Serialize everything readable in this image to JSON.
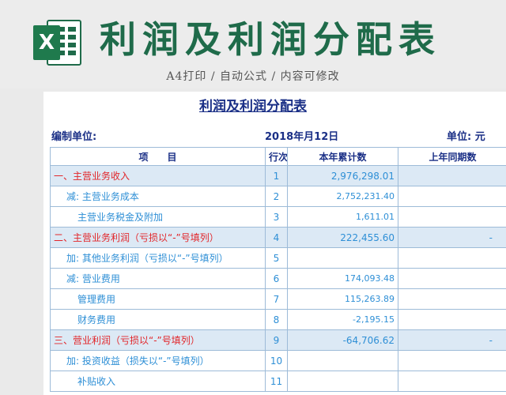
{
  "banner": {
    "title": "利润及利润分配表",
    "subtitle": "A4打印 / 自动公式 / 内容可修改",
    "icon": "excel-icon",
    "brand_color": "#1f6b4a"
  },
  "sheet": {
    "title": "利润及利润分配表",
    "unit_label": "编制单位:",
    "date": "2018年月12日",
    "currency_label": "单位: 元",
    "columns": [
      "项　　目",
      "行次",
      "本年累计数",
      "上年同期数"
    ],
    "rows": [
      {
        "name": "一、主营业务收入",
        "idx": "1",
        "current": "2,976,298.01",
        "previous": "",
        "highlight": true,
        "level": 0,
        "red": true
      },
      {
        "name": "减: 主营业务成本",
        "idx": "2",
        "current": "2,752,231.40",
        "previous": "",
        "highlight": false,
        "level": 1,
        "red": false
      },
      {
        "name": "主营业务税金及附加",
        "idx": "3",
        "current": "1,611.01",
        "previous": "",
        "highlight": false,
        "level": 2,
        "red": false
      },
      {
        "name": "二、主营业务利润（亏损以“-”号填列）",
        "idx": "4",
        "current": "222,455.60",
        "previous": "-",
        "highlight": true,
        "level": 0,
        "red": true
      },
      {
        "name": "加: 其他业务利润（亏损以“-”号填列）",
        "idx": "5",
        "current": "",
        "previous": "",
        "highlight": false,
        "level": 1,
        "red": false
      },
      {
        "name": "减: 营业费用",
        "idx": "6",
        "current": "174,093.48",
        "previous": "",
        "highlight": false,
        "level": 1,
        "red": false
      },
      {
        "name": "管理费用",
        "idx": "7",
        "current": "115,263.89",
        "previous": "",
        "highlight": false,
        "level": 2,
        "red": false
      },
      {
        "name": "财务费用",
        "idx": "8",
        "current": "-2,195.15",
        "previous": "",
        "highlight": false,
        "level": 2,
        "red": false
      },
      {
        "name": "三、营业利润（亏损以“-”号填列）",
        "idx": "9",
        "current": "-64,706.62",
        "previous": "-",
        "highlight": true,
        "level": 0,
        "red": true
      },
      {
        "name": "加: 投资收益（损失以“-”号填列）",
        "idx": "10",
        "current": "",
        "previous": "",
        "highlight": false,
        "level": 1,
        "red": false
      },
      {
        "name": "补贴收入",
        "idx": "11",
        "current": "",
        "previous": "",
        "highlight": false,
        "level": 2,
        "red": false
      }
    ]
  }
}
